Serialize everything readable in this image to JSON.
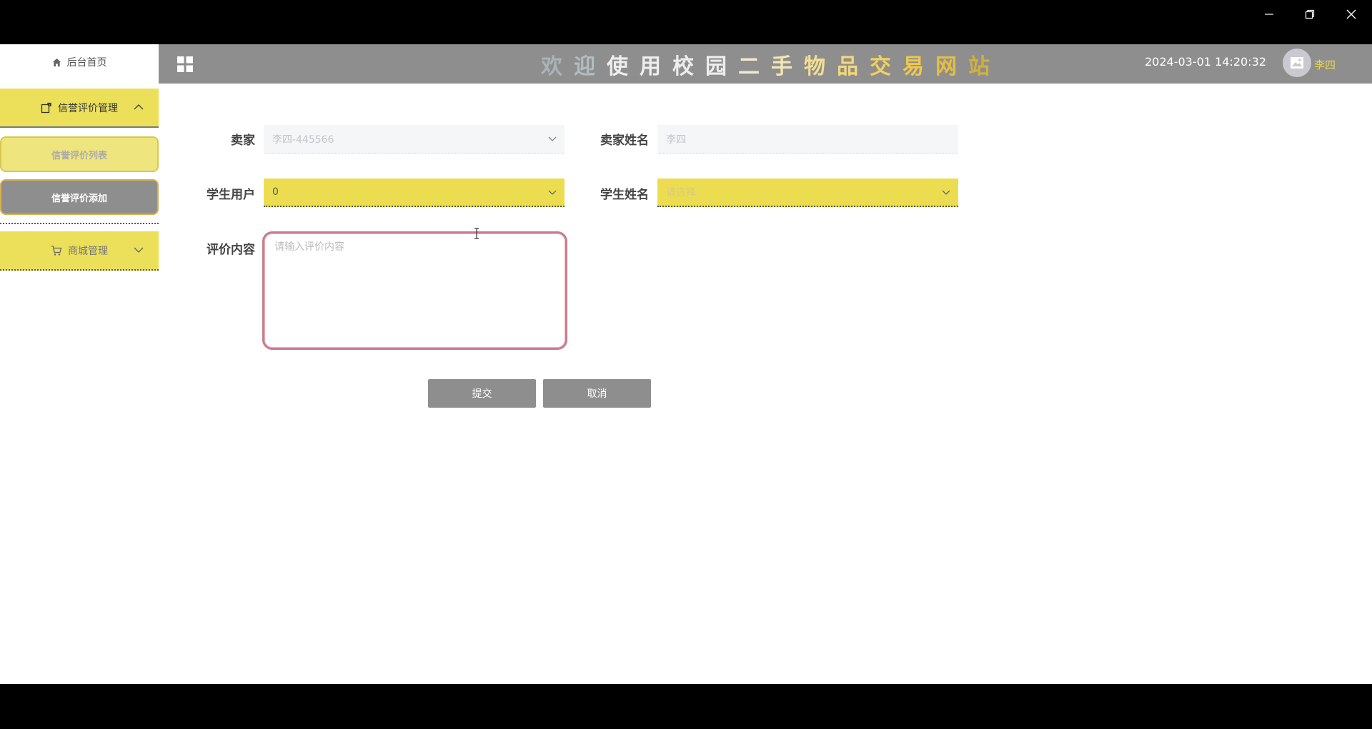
{
  "window": {
    "minimize_icon": "minimize-icon",
    "maximize_icon": "restore-icon",
    "close_icon": "close-icon"
  },
  "header": {
    "welcome_chars": [
      {
        "ch": "欢",
        "color": "#a9b4b6"
      },
      {
        "ch": "迎",
        "color": "#b3bcc0"
      },
      {
        "ch": "使",
        "color": "#eeeeee"
      },
      {
        "ch": "用",
        "color": "#eeeeee"
      },
      {
        "ch": "校",
        "color": "#eeeeee"
      },
      {
        "ch": "园",
        "color": "#eeeeee"
      },
      {
        "ch": "二",
        "color": "#f0ead0"
      },
      {
        "ch": "手",
        "color": "#f3e7b6"
      },
      {
        "ch": "物",
        "color": "#f4de92"
      },
      {
        "ch": "品",
        "color": "#f4d878"
      },
      {
        "ch": "交",
        "color": "#f2d060"
      },
      {
        "ch": "易",
        "color": "#efc94c"
      },
      {
        "ch": "网",
        "color": "#e4bf44"
      },
      {
        "ch": "站",
        "color": "#d2b13c"
      }
    ],
    "datetime": "2024-03-01 14:20:32",
    "username": "李四",
    "menu_toggle_icon": "grid-icon",
    "avatar_icon": "image-icon"
  },
  "sidebar": {
    "home_label": "后台首页",
    "menus": [
      {
        "label": "信誉评价管理",
        "icon": "edit-icon",
        "expanded": true,
        "items": [
          {
            "label": "信誉评价列表"
          },
          {
            "label": "信誉评价添加",
            "active": true
          }
        ]
      },
      {
        "label": "商城管理",
        "icon": "cart-icon",
        "expanded": false
      }
    ]
  },
  "form": {
    "seller_label": "卖家",
    "seller_value": "李四-445566",
    "seller_name_label": "卖家姓名",
    "seller_name_value": "李四",
    "student_label": "学生用户",
    "student_value": "0",
    "student_name_label": "学生姓名",
    "student_name_placeholder": "请选择",
    "content_label": "评价内容",
    "content_placeholder": "请输入评价内容",
    "submit_label": "提交",
    "cancel_label": "取消"
  },
  "colors": {
    "accent_yellow": "#ecdd50",
    "header_gray": "#8e8e8e",
    "focus_border": "#c97c8c"
  }
}
